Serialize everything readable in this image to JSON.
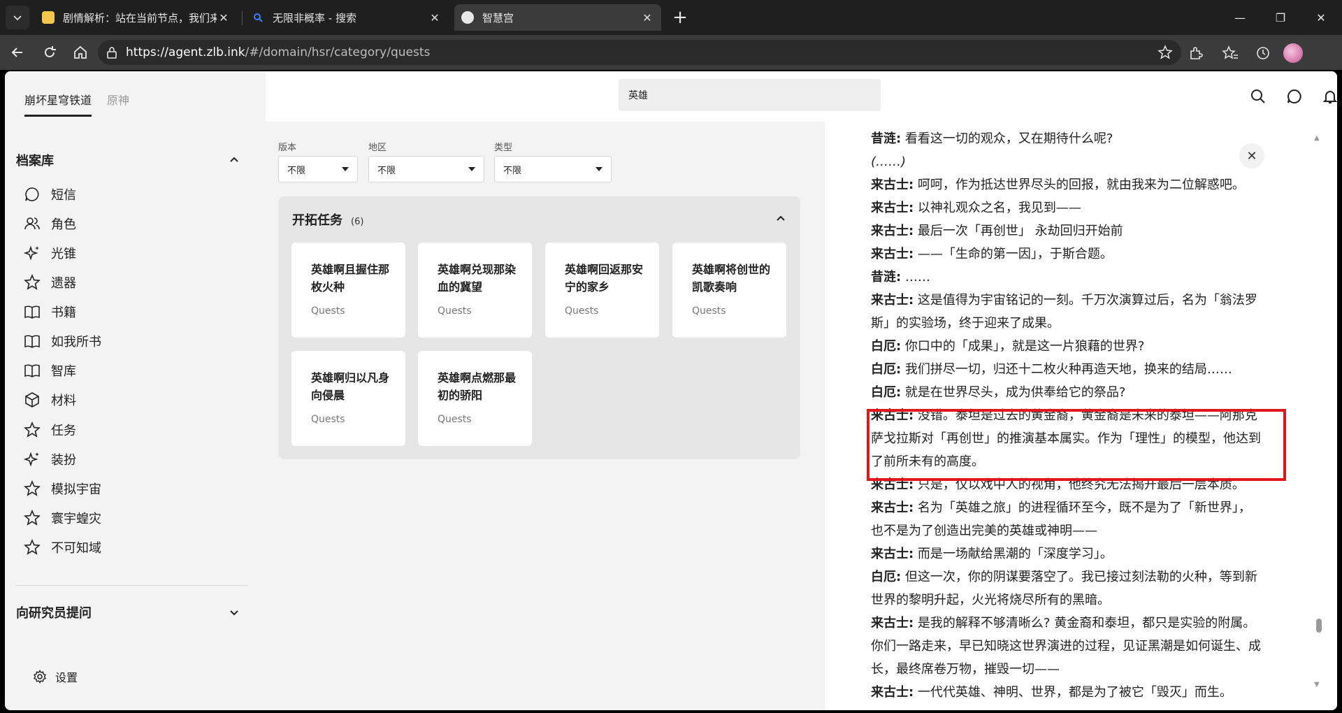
{
  "browser": {
    "tabs": [
      {
        "title": "剧情解析：站在当前节点，我们来",
        "active": false
      },
      {
        "title": "无限非概率 - 搜索",
        "active": false
      },
      {
        "title": "智慧宫",
        "active": true
      }
    ],
    "url_host": "https://agent.zlb.ink",
    "url_path": "/#/domain/hsr/category/quests"
  },
  "sidebar": {
    "game_tabs": [
      "崩坏星穹铁道",
      "原神"
    ],
    "archive_title": "档案库",
    "items": [
      {
        "label": "短信",
        "icon": "message-icon"
      },
      {
        "label": "角色",
        "icon": "users-icon"
      },
      {
        "label": "光锥",
        "icon": "sparkle-icon"
      },
      {
        "label": "遗器",
        "icon": "star-icon"
      },
      {
        "label": "书籍",
        "icon": "book-icon"
      },
      {
        "label": "如我所书",
        "icon": "book-icon"
      },
      {
        "label": "智库",
        "icon": "book-icon"
      },
      {
        "label": "材料",
        "icon": "cube-icon"
      },
      {
        "label": "任务",
        "icon": "star-icon"
      },
      {
        "label": "装扮",
        "icon": "sparkle-icon"
      },
      {
        "label": "模拟宇宙",
        "icon": "star-icon"
      },
      {
        "label": "寰宇蝗灾",
        "icon": "star-icon"
      },
      {
        "label": "不可知域",
        "icon": "star-icon"
      }
    ],
    "ask_title": "向研究员提问",
    "settings_label": "设置"
  },
  "search": {
    "value": "英雄"
  },
  "filters": [
    {
      "label": "版本",
      "value": "不限"
    },
    {
      "label": "地区",
      "value": "不限"
    },
    {
      "label": "类型",
      "value": "不限"
    }
  ],
  "panel": {
    "title": "开拓任务",
    "count": "(6)",
    "cards": [
      {
        "title": "英雄啊且握住那枚火种",
        "sub": "Quests"
      },
      {
        "title": "英雄啊兑现那染血的冀望",
        "sub": "Quests"
      },
      {
        "title": "英雄啊回返那安宁的家乡",
        "sub": "Quests"
      },
      {
        "title": "英雄啊将创世的凯歌奏响",
        "sub": "Quests"
      },
      {
        "title": "英雄啊归以凡身向侵晨",
        "sub": "Quests"
      },
      {
        "title": "英雄啊点燃那最初的骄阳",
        "sub": "Quests"
      }
    ]
  },
  "dialogue": [
    {
      "speaker": "昔涟:",
      "text": " 看看这一切的观众，又在期待什么呢?"
    },
    {
      "speaker": "",
      "text": "(……)"
    },
    {
      "speaker": "来古士:",
      "text": " 呵呵，作为抵达世界尽头的回报，就由我来为二位解惑吧。"
    },
    {
      "speaker": "来古士:",
      "text": " 以神礼观众之名，我见到——"
    },
    {
      "speaker": "来古士:",
      "text": " 最后一次「再创世」 永劫回归开始前"
    },
    {
      "speaker": "来古士:",
      "text": " ——「生命的第一因」，于斯合题。"
    },
    {
      "speaker": "昔涟:",
      "text": " ……"
    },
    {
      "speaker": "来古士:",
      "text": " 这是值得为宇宙铭记的一刻。千万次演算过后，名为「翁法罗"
    },
    {
      "speaker": "",
      "text": "斯」的实验场，终于迎来了成果。"
    },
    {
      "speaker": "白厄:",
      "text": " 你口中的「成果」，就是这一片狼藉的世界?"
    },
    {
      "speaker": "白厄:",
      "text": " 我们拼尽一切，归还十二枚火种再造天地，换来的结局……"
    },
    {
      "speaker": "白厄:",
      "text": " 就是在世界尽头，成为供奉给它的祭品?"
    },
    {
      "speaker": "来古士:",
      "text": " 没错。泰坦是过去的黄金裔，黄金裔是未来的泰坦——阿那克"
    },
    {
      "speaker": "",
      "text": "萨戈拉斯对「再创世」的推演基本属实。作为「理性」的模型，他达到"
    },
    {
      "speaker": "",
      "text": "了前所未有的高度。"
    },
    {
      "speaker": "来古士:",
      "text": " 只是，仅以戏中人的视角，他终究无法揭开最后一层本质。"
    },
    {
      "speaker": "来古士:",
      "text": " 名为「英雄之旅」的进程循环至今，既不是为了「新世界」，"
    },
    {
      "speaker": "",
      "text": "也不是为了创造出完美的英雄或神明——"
    },
    {
      "speaker": "来古士:",
      "text": " 而是一场献给黑潮的「深度学习」。"
    },
    {
      "speaker": "白厄:",
      "text": " 但这一次，你的阴谋要落空了。我已接过刻法勒的火种，等到新"
    },
    {
      "speaker": "",
      "text": "世界的黎明升起，火光将烧尽所有的黑暗。"
    },
    {
      "speaker": "来古士:",
      "text": " 是我的解释不够清晰么? 黄金裔和泰坦，都只是实验的附属。"
    },
    {
      "speaker": "",
      "text": "你们一路走来，早已知晓这世界演进的过程，见证黑潮是如何诞生、成"
    },
    {
      "speaker": "",
      "text": "长，最终席卷万物，摧毁一切——"
    },
    {
      "speaker": "来古士:",
      "text": " 一代代英雄、神明、世界，都是为了被它「毁灭」而生。"
    }
  ],
  "colors": {
    "highlight": "#e0171d",
    "accent": "#222222"
  }
}
